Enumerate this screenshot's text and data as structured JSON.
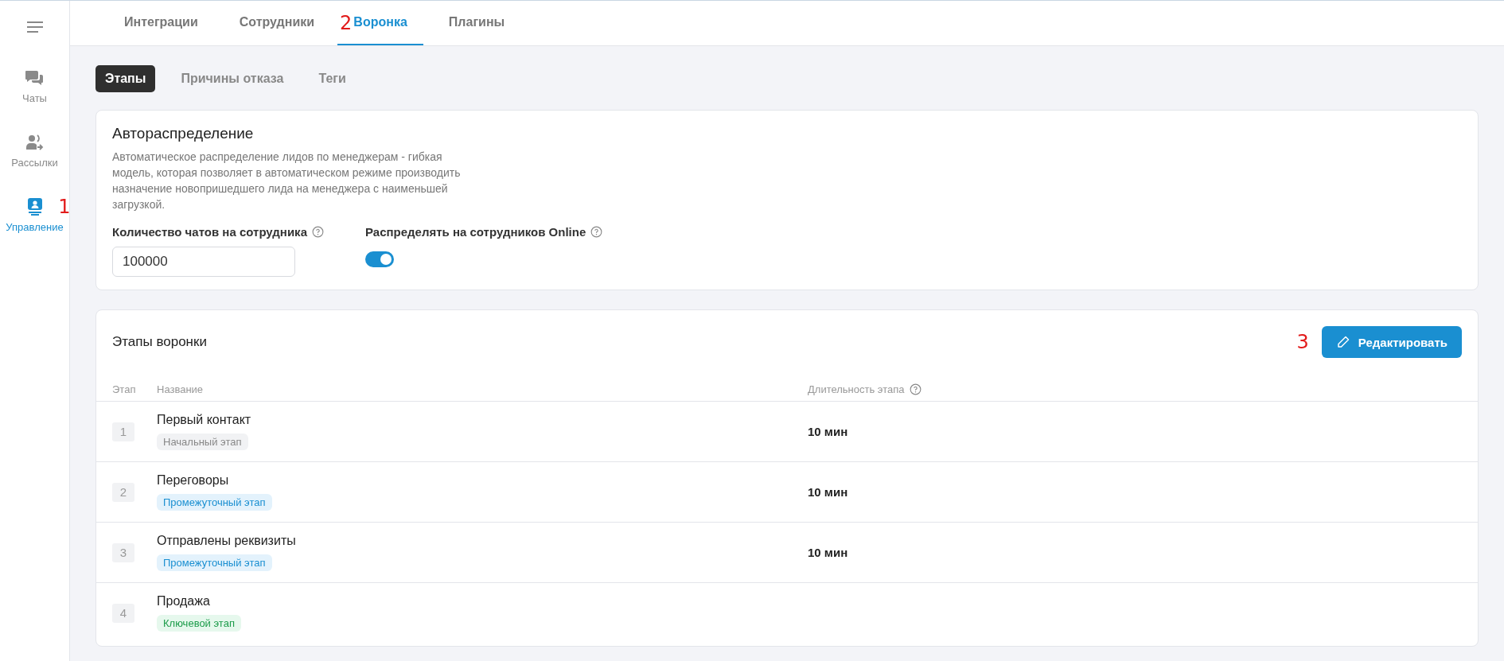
{
  "sidebar": {
    "items": [
      {
        "label": "Чаты",
        "kind": "chat",
        "selected": false
      },
      {
        "label": "Рассылки",
        "kind": "mailing",
        "selected": false
      },
      {
        "label": "Управление",
        "kind": "manage",
        "selected": true,
        "callout": "1"
      }
    ]
  },
  "tabs": [
    {
      "label": "Интеграции",
      "selected": false
    },
    {
      "label": "Сотрудники",
      "selected": false
    },
    {
      "label": "Воронка",
      "selected": true,
      "callout": "2"
    },
    {
      "label": "Плагины",
      "selected": false
    }
  ],
  "subtabs": [
    {
      "label": "Этапы",
      "selected": true
    },
    {
      "label": "Причины отказа",
      "selected": false
    },
    {
      "label": "Теги",
      "selected": false
    }
  ],
  "autodistribution": {
    "title": "Автораспределение",
    "description": "Автоматическое распределение лидов по менеджерам - гибкая модель, которая позволяет в автоматическом режиме производить назначение новопришедшего лида на менеджера с наименьшей загрузкой.",
    "chats_label": "Количество чатов на сотрудника",
    "chats_value": "100000",
    "online_label": "Распределять на сотрудников Online",
    "online": true
  },
  "stages": {
    "title": "Этапы воронки",
    "edit_button": "Редактировать",
    "edit_callout": "3",
    "columns": [
      "Этап",
      "Название",
      "Длительность этапа"
    ],
    "rows": [
      {
        "number": "1",
        "name": "Первый контакт",
        "tag": "Начальный этап",
        "kind": "start",
        "duration": "10 мин"
      },
      {
        "number": "2",
        "name": "Переговоры",
        "tag": "Промежуточный этап",
        "kind": "intermediate",
        "duration": "10 мин"
      },
      {
        "number": "3",
        "name": "Отправлены реквизиты",
        "tag": "Промежуточный этап",
        "kind": "intermediate",
        "duration": "10 мин"
      },
      {
        "number": "4",
        "name": "Продажа",
        "tag": "Ключевой этап",
        "kind": "key"
      }
    ]
  }
}
